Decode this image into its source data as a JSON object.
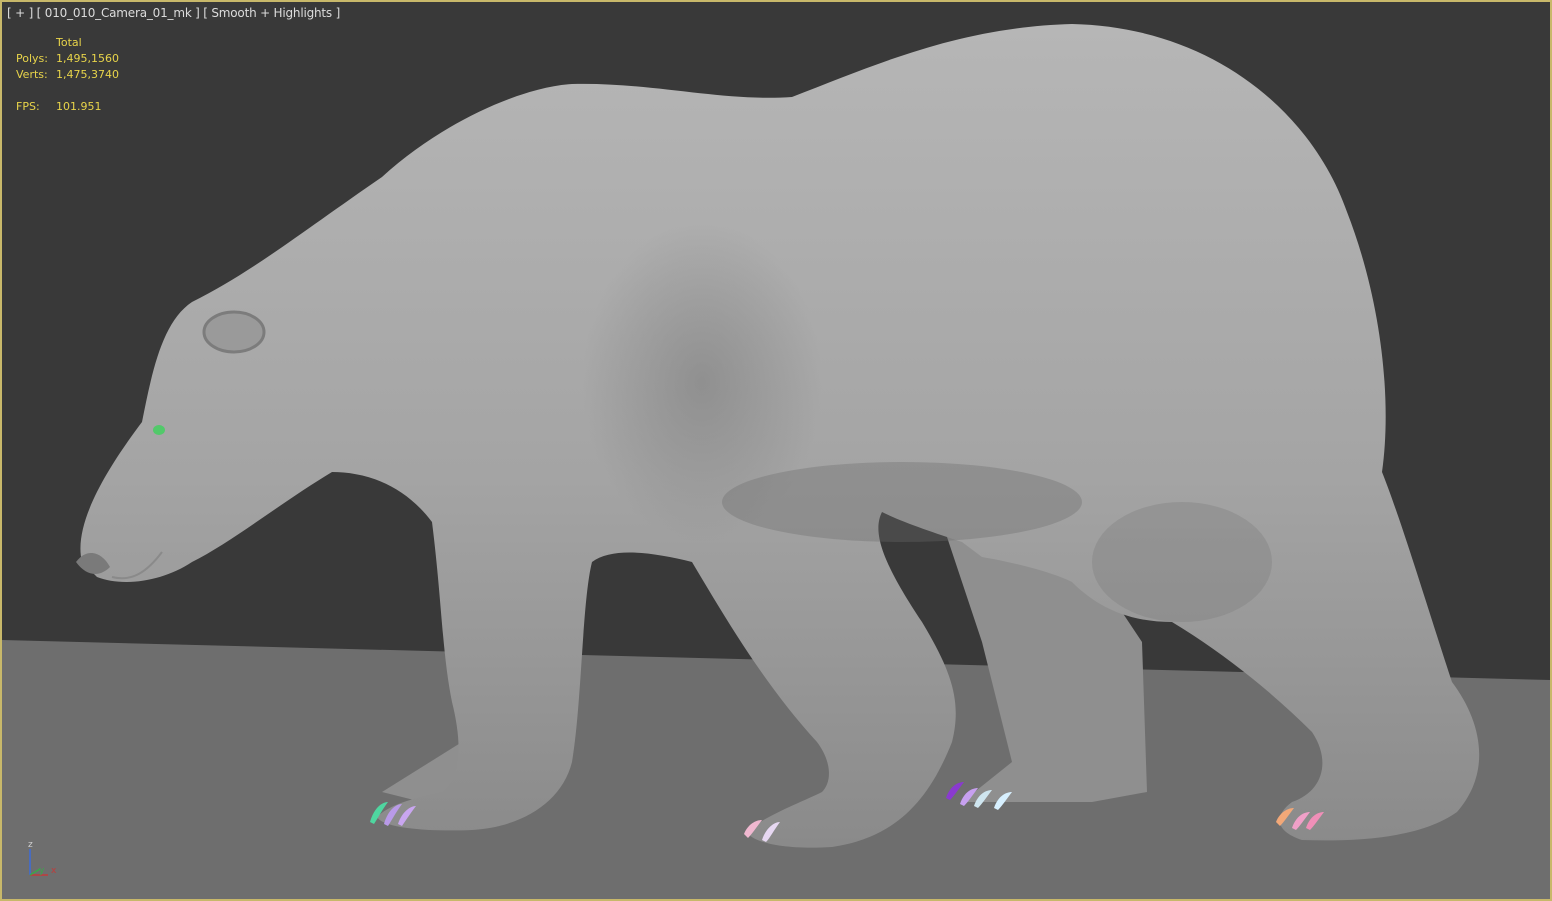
{
  "viewport": {
    "label": "[ + ] [ 010_010_Camera_01_mk ] [ Smooth + Highlights ]"
  },
  "stats": {
    "header": "Total",
    "polys_label": "Polys:",
    "polys_total": "1,495,156",
    "polys_selected": "0",
    "verts_label": "Verts:",
    "verts_total": "1,475,374",
    "verts_selected": "0",
    "fps_label": "FPS:",
    "fps_value": "101.951"
  },
  "axis": {
    "z_label": "z",
    "y_label": "y",
    "x_label": "x"
  },
  "colors": {
    "border": "#c8b86a",
    "background": "#393939",
    "ground": "#6e6e6e",
    "stats_text": "#e8d44a"
  },
  "scene": {
    "subject": "polar-bear-model"
  }
}
